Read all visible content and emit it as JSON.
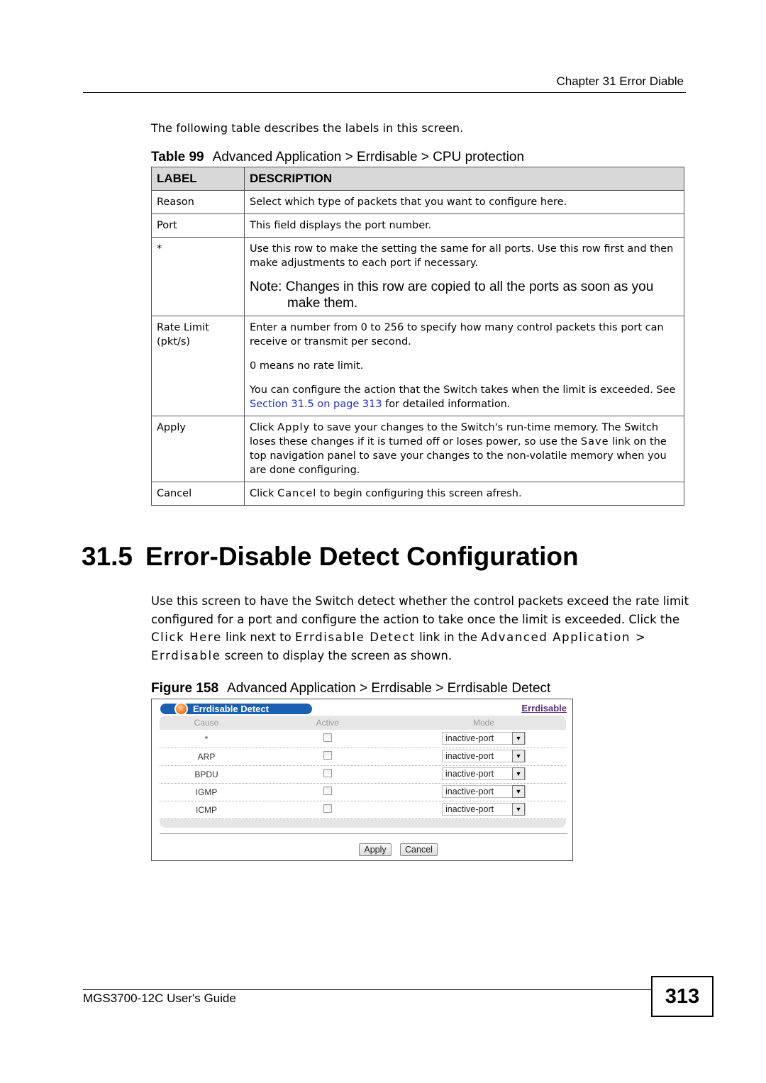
{
  "header": {
    "chapter": "Chapter 31 Error Diable"
  },
  "intro": "The following table describes the labels in this screen.",
  "table": {
    "caption_number": "Table 99",
    "caption_title": "Advanced Application > Errdisable > CPU protection",
    "columns": [
      "LABEL",
      "DESCRIPTION"
    ],
    "rows": [
      {
        "label": "Reason",
        "description": "Select which type of packets that you want to configure here."
      },
      {
        "label": "Port",
        "description": "This field displays the port number."
      },
      {
        "label": "*",
        "description": "Use this row to make the setting the same for all ports. Use this row first and then make adjustments to each port if necessary.",
        "note": "Note: Changes in this row are copied to all the ports as soon as you make them."
      },
      {
        "label": "Rate Limit (pkt/s)",
        "description": "Enter a number from 0 to 256 to specify how many control packets this port can receive or transmit per second.",
        "para2": "0 means no rate limit.",
        "para3_before": "You can configure the action that the Switch takes when the limit is exceeded. See ",
        "para3_link": "Section 31.5 on page 313",
        "para3_after": " for detailed information."
      },
      {
        "label": "Apply",
        "d_pre": "Click ",
        "d_kw1": "Apply",
        "d_mid": " to save your changes to the Switch's run-time memory. The Switch loses these changes if it is turned off or loses power, so use the ",
        "d_kw2": "Save",
        "d_post": " link on the top navigation panel to save your changes to the non-volatile memory when you are done configuring."
      },
      {
        "label": "Cancel",
        "d_pre": "Click ",
        "d_kw1": "Cancel",
        "d_post": " to begin configuring this screen afresh."
      }
    ]
  },
  "section": {
    "number": "31.5",
    "title": "Error-Disable Detect Configuration"
  },
  "body": {
    "p1": "Use this screen to have the Switch detect whether the control packets exceed the rate limit configured for a port and configure the action to take once the limit is exceeded. Click the ",
    "kw1": "Click Here",
    "p2": " link next to ",
    "kw2": "Errdisable Detect",
    "p3": " link in the ",
    "kw3": "Advanced Application > Errdisable",
    "p4": " screen to display the screen as shown."
  },
  "figure": {
    "caption_number": "Figure 158",
    "caption_title": "Advanced Application > Errdisable > Errdisable Detect",
    "panel_title": "Errdisable Detect",
    "top_link": "Errdisable",
    "columns": {
      "cause": "Cause",
      "active": "Active",
      "mode": "Mode"
    },
    "rows": [
      {
        "cause": "*",
        "active": false,
        "mode": "inactive-port"
      },
      {
        "cause": "ARP",
        "active": false,
        "mode": "inactive-port"
      },
      {
        "cause": "BPDU",
        "active": false,
        "mode": "inactive-port"
      },
      {
        "cause": "IGMP",
        "active": false,
        "mode": "inactive-port"
      },
      {
        "cause": "ICMP",
        "active": false,
        "mode": "inactive-port"
      }
    ],
    "apply_label": "Apply",
    "cancel_label": "Cancel"
  },
  "footer": {
    "guide": "MGS3700-12C User's Guide",
    "page": "313"
  }
}
